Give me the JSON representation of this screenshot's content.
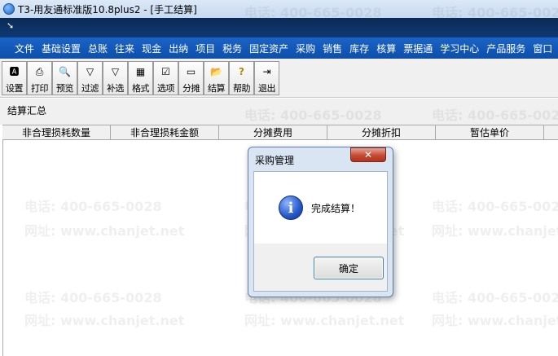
{
  "window": {
    "title": "T3-用友通标准版10.8plus2 - [手工结算]"
  },
  "menu": [
    "文件",
    "基础设置",
    "总账",
    "往来",
    "现金",
    "出纳",
    "项目",
    "税务",
    "固定资产",
    "采购",
    "销售",
    "库存",
    "核算",
    "票据通",
    "学习中心",
    "产品服务",
    "窗口"
  ],
  "toolbar": [
    {
      "label": "设置",
      "icon": "settings-icon",
      "glyph": "🅰"
    },
    {
      "label": "打印",
      "icon": "print-icon",
      "glyph": "⎙"
    },
    {
      "label": "预览",
      "icon": "preview-icon",
      "glyph": "🔍"
    },
    {
      "label": "过滤",
      "icon": "filter-icon",
      "glyph": "▽"
    },
    {
      "label": "补选",
      "icon": "filter-add-icon",
      "glyph": "▽"
    },
    {
      "label": "格式",
      "icon": "format-icon",
      "glyph": "▦"
    },
    {
      "label": "选项",
      "icon": "options-icon",
      "glyph": "☑"
    },
    {
      "label": "分摊",
      "icon": "allocate-icon",
      "glyph": "▭"
    },
    {
      "label": "结算",
      "icon": "settle-icon",
      "glyph": "📂"
    },
    {
      "label": "帮助",
      "icon": "help-icon",
      "glyph": "?"
    },
    {
      "label": "退出",
      "icon": "exit-icon",
      "glyph": "⇥"
    }
  ],
  "summary": {
    "label": "结算汇总"
  },
  "table": {
    "columns": [
      "非合理损耗数量",
      "非合理损耗金额",
      "分摊费用",
      "分摊折扣",
      "暂估单价"
    ]
  },
  "watermarks": {
    "phone": "电话: 400-665-0028",
    "site": "网址: www.chanjet.net"
  },
  "dialog": {
    "title": "采购管理",
    "message": "完成结算！",
    "ok_label": "确定",
    "close_glyph": "✕"
  },
  "colors": {
    "menubar": "#0d4fab",
    "dialog_close": "#c44a33"
  }
}
